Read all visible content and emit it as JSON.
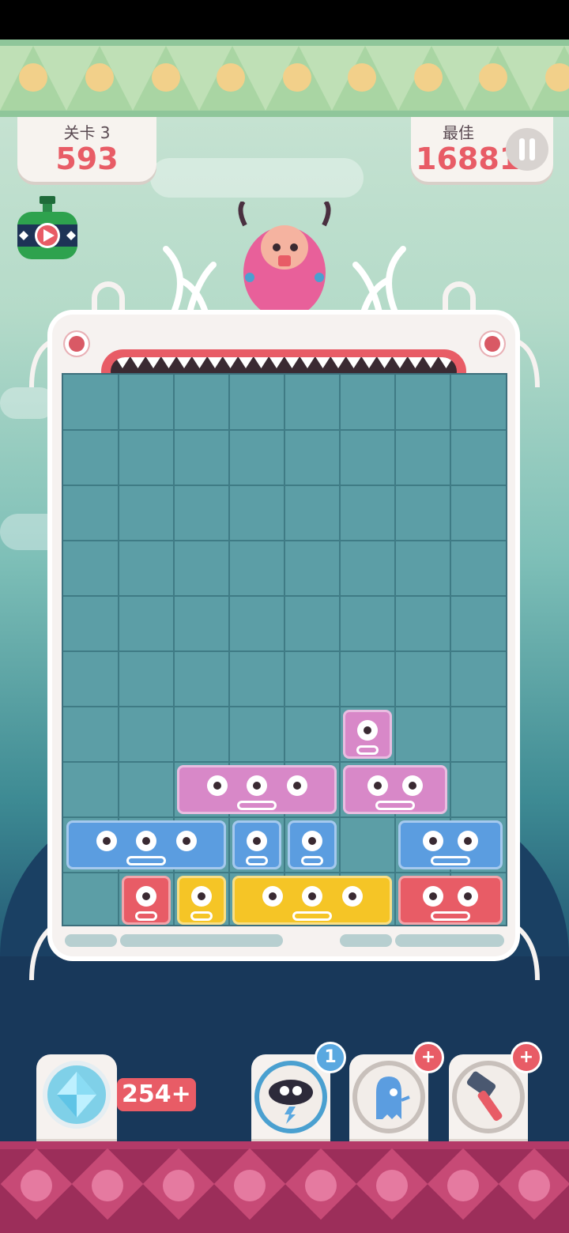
{
  "level": {
    "label": "关卡 3",
    "score": "593"
  },
  "best": {
    "label": "最佳",
    "score": "16881"
  },
  "gems": {
    "count": "254+"
  },
  "powerups": {
    "storm_count": "1",
    "ghost_badge": "+",
    "hammer_badge": "+"
  },
  "colors": {
    "red": "#e85c66",
    "pink": "#d888c8",
    "blue": "#5b9de0",
    "yellow": "#f5c526"
  },
  "board": {
    "columns": 8,
    "rows": 10,
    "blocks": [
      {
        "color": "pink",
        "row": 6,
        "col": 5,
        "width": 1,
        "eyes": 1
      },
      {
        "color": "pink",
        "row": 7,
        "col": 2,
        "width": 3,
        "eyes": 3
      },
      {
        "color": "pink",
        "row": 7,
        "col": 5,
        "width": 2,
        "eyes": 2
      },
      {
        "color": "blue",
        "row": 8,
        "col": 0,
        "width": 3,
        "eyes": 3
      },
      {
        "color": "blue",
        "row": 8,
        "col": 3,
        "width": 1,
        "eyes": 1
      },
      {
        "color": "blue",
        "row": 8,
        "col": 4,
        "width": 1,
        "eyes": 1
      },
      {
        "color": "blue",
        "row": 8,
        "col": 6,
        "width": 2,
        "eyes": 2
      },
      {
        "color": "red",
        "row": 9,
        "col": 1,
        "width": 1,
        "eyes": 1
      },
      {
        "color": "yellow",
        "row": 9,
        "col": 2,
        "width": 1,
        "eyes": 1
      },
      {
        "color": "yellow",
        "row": 9,
        "col": 3,
        "width": 3,
        "eyes": 3
      },
      {
        "color": "red",
        "row": 9,
        "col": 6,
        "width": 2,
        "eyes": 2
      }
    ]
  }
}
